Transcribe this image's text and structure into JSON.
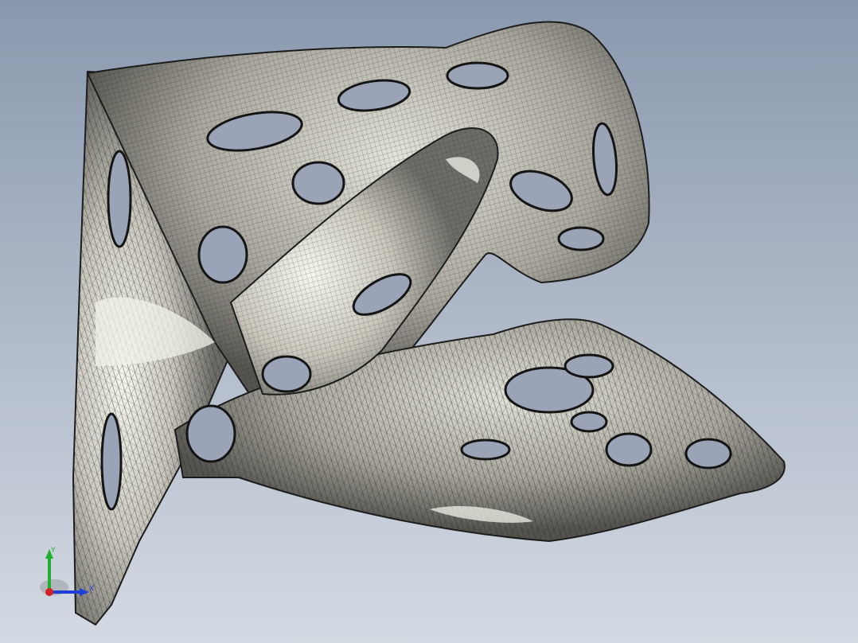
{
  "viewport": {
    "background_top": "#8a98ae",
    "background_bottom": "#d4dae3"
  },
  "model": {
    "body_color": "#c9c7bc",
    "mesh_color": "#2a2a2a",
    "hole_color": "#9aa4b6",
    "highlight_color": "#f2f2ea"
  },
  "triad": {
    "x_label": "X",
    "y_label": "Y",
    "x_color": "#1f3fd6",
    "y_color": "#1fb02f",
    "z_color": "#d42020"
  }
}
